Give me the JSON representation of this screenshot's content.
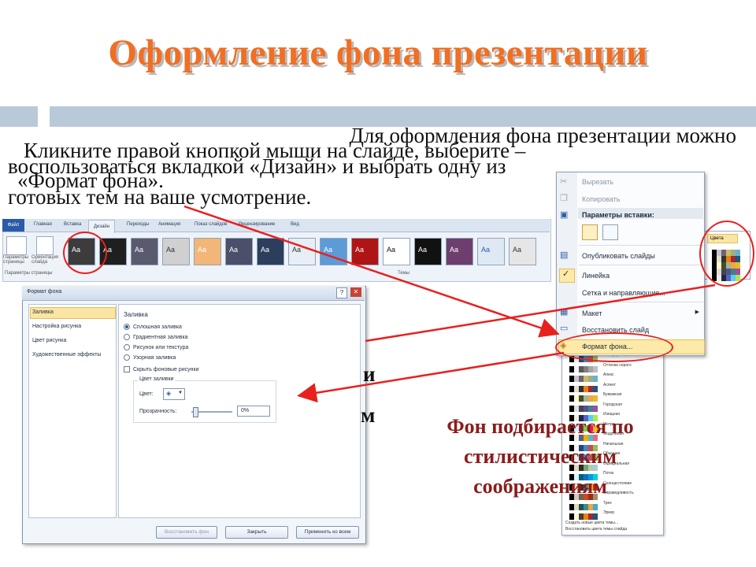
{
  "slide": {
    "title": "Оформление фона презентации",
    "body_lines": [
      "Для оформления фона презентации можно",
      "воспользоваться вкладкой «Дизайн» и выбрать одну из",
      "готовых тем на ваше усмотрение."
    ],
    "overlay_lines": [
      "Кликните правой кнопкой мыши на слайде, выберите –",
      "«Формат фона»."
    ],
    "caption_lines": [
      "Фон подбирается по",
      "стилистическим",
      "соображениям"
    ],
    "hidden_fragment_1": "и",
    "hidden_fragment_2": "м"
  },
  "ribbon": {
    "tabs": [
      "Файл",
      "Главная",
      "Вставка",
      "Дизайн",
      "Переходы",
      "Анимация",
      "Показ слайдов",
      "Рецензирование",
      "Вид"
    ],
    "active_tab": "Дизайн",
    "group1_buttons": [
      "Параметры страницы",
      "Ориентация слайда"
    ],
    "group1_label": "Параметры страницы",
    "themes_label": "Темы",
    "theme_thumb_text": "Aa",
    "colors_button": "Цвета"
  },
  "dialog": {
    "title": "Формат фона",
    "nav": [
      "Заливка",
      "Настройка рисунка",
      "Цвет рисунка",
      "Художественные эффекты"
    ],
    "section": "Заливка",
    "options": [
      "Сплошная заливка",
      "Градиентная заливка",
      "Рисунок или текстура",
      "Узорная заливка"
    ],
    "hide_bg_label": "Скрыть фоновые рисунки",
    "fill_color_group": "Цвет заливки",
    "color_label": "Цвет:",
    "transparency_label": "Прозрачность:",
    "transparency_value": "0%",
    "buttons": [
      "Восстановить фон",
      "Закрыть",
      "Применить ко всем"
    ]
  },
  "context_menu": {
    "items": [
      "Вырезать",
      "Копировать",
      "Параметры вставки:",
      "Опубликовать слайды",
      "Линейка",
      "Сетка и направляющие...",
      "Макет",
      "Восстановить слайд",
      "Формат фона..."
    ]
  },
  "gallery": {
    "palette_names": [
      "Стандартная",
      "Оттенки серого",
      "Апекс",
      "Аспект",
      "Бумажная",
      "Городская",
      "Изящная",
      "Метро",
      "Модульная",
      "Начальная",
      "Обычная",
      "Официальная",
      "Поток",
      "Солнцестояние",
      "Справедливость",
      "Трек",
      "Эркер"
    ],
    "footer": [
      "Создать новые цвета темы...",
      "Восстановить цвета темы слайда"
    ]
  },
  "colors": {
    "title": "#f26e22",
    "bar": "#b8c9d9",
    "caption": "#8b1c1c",
    "annotation_red": "#e8201e"
  }
}
